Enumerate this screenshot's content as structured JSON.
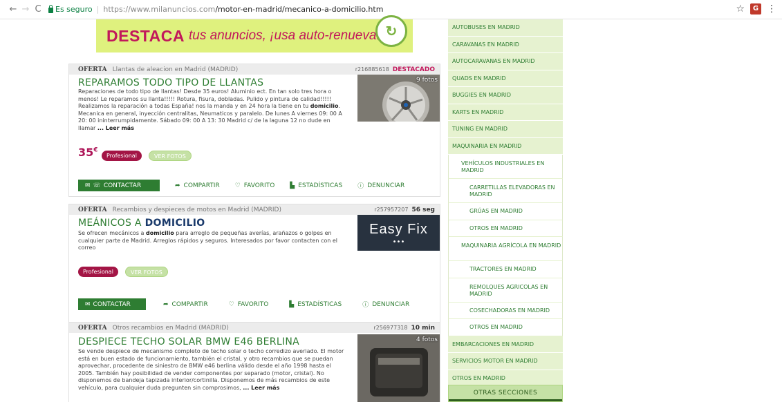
{
  "browser": {
    "secure_label": "Es seguro",
    "url_host": "https://www.milanuncios.com",
    "url_path": "/motor-en-madrid/mecanico-a-domicilio.htm"
  },
  "banner": {
    "big": "DESTACA",
    "rest": "tus anuncios, ¡usa auto-renueva!"
  },
  "ads": [
    {
      "tipo": "OFERTA",
      "category": "Llantas de aleacion en Madrid (MADRID)",
      "ref": "r216885618",
      "flag": "DESTACADO",
      "title": "REPARAMOS TODO TIPO DE LLANTAS",
      "description_parts": [
        "Reparaciones de todo tipo de llantas! Desde 35 euros! Aluminio ect. En tan solo tres hora o menos! Le reparamos su llanta!!!!! Rotura, fisura, dobladas. Pulido y pintura de calidad!!!!! Realizamos la reparación a todas España! nos la manda y en 24 hora la tiene en tu ",
        "domicilio",
        ". Mecanica en general, inyección centralitas, Neumaticos y paralelo. De lunes A viernes 09: 00 A 20: 00 ininterrumpidamente. Sábado 09: 00 A 13: 30 Madrid c/ de la laguna 12 no dude en llamar ",
        "... Leer más"
      ],
      "photos": "9 fotos",
      "price": "35",
      "currency": "€",
      "pro_label": "Profesional",
      "fotos_label": "VER FOTOS"
    },
    {
      "tipo": "OFERTA",
      "category": "Recambios y despieces de motos en Madrid (MADRID)",
      "ref": "r257957207",
      "time": "56 seg",
      "title_plain": "MEÁNICOS A ",
      "title_bold": "DOMICILIO",
      "description_parts": [
        "Se ofrecen mecánicos a ",
        "domicilio",
        " para arreglo de pequeñas averías, arañazos o golpes en cualquier parte de Madrid. Arreglos rápidos y seguros. Interesados por favor contacten con el correo"
      ],
      "logo_text": "Easy Fix",
      "pro_label": "Profesional",
      "fotos_label": "VER FOTOS"
    },
    {
      "tipo": "OFERTA",
      "category": "Otros recambios en Madrid (MADRID)",
      "ref": "r256977318",
      "time": "10 min",
      "title": "DESPIECE TECHO SOLAR BMW E46 BERLINA",
      "description_parts": [
        "Se vende despiece de mecanismo completo de techo solar o techo corredizo averiado. El motor está en buen estado de funcionamiento, también el cristal, y otro recambios que se puedan aprovechar, procedente de siniestro de BMW e46 berlina válido desde el año 1998 hasta el 2005. También hay posibilidad de vender componentes por separado (motor, cristal). No disponemos de bandeja tapizada interior/cortinilla. Disponemos de más recambios de este vehículo, para cualquier duda pregunten sin comprosimos, ",
        "... Leer más"
      ],
      "photos": "4 fotos"
    }
  ],
  "actions": {
    "contact": "CONTACTAR",
    "share": "COMPARTIR",
    "favorite": "FAVORITO",
    "stats": "ESTADÍSTICAS",
    "report": "DENUNCIAR"
  },
  "sidebar": {
    "items": [
      "AUTOBUSES EN MADRID",
      "CARAVANAS EN MADRID",
      "AUTOCARAVANAS EN MADRID",
      "QUADS EN MADRID",
      "BUGGIES EN MADRID",
      "KARTS EN MADRID",
      "TUNING EN MADRID",
      "MAQUINARIA EN MADRID",
      "VEHÍCULOS INDUSTRIALES EN MADRID",
      "CARRETILLAS ELEVADORAS EN MADRID",
      "GRÚAS EN MADRID",
      "OTROS EN MADRID",
      "MAQUINARIA AGRÍCOLA EN MADRID",
      "TRACTORES EN MADRID",
      "REMOLQUES AGRICOLAS EN MADRID",
      "COSECHADORAS EN MADRID",
      "OTROS EN MADRID",
      "EMBARCACIONES EN MADRID",
      "SERVICIOS MOTOR EN MADRID",
      "OTROS EN MADRID"
    ],
    "other_sections": "OTRAS SECCIONES"
  }
}
